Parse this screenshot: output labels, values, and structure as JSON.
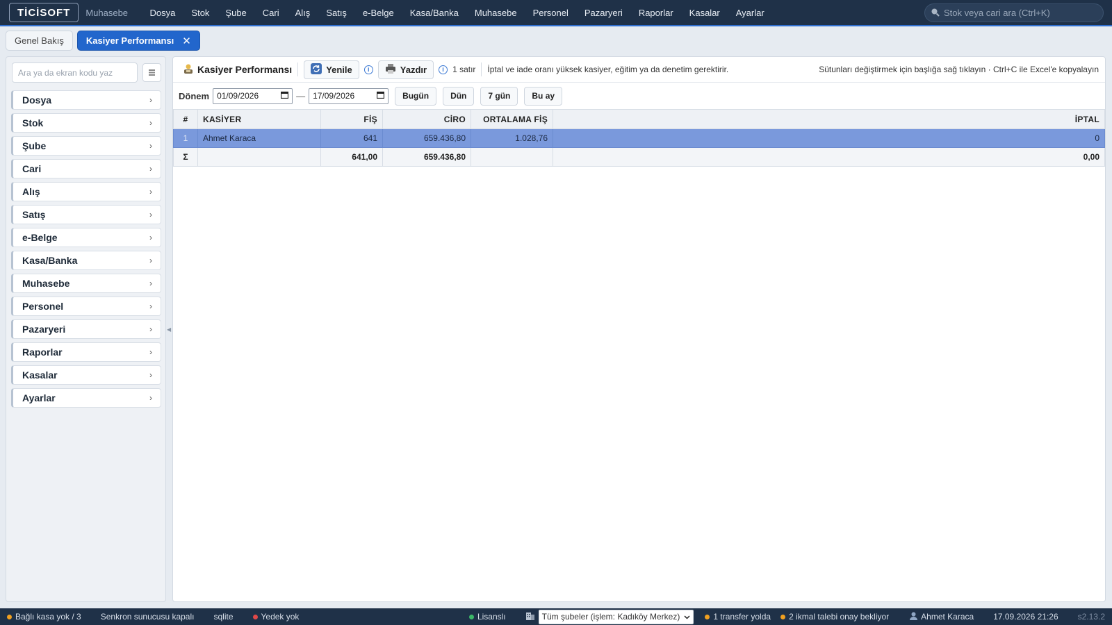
{
  "app": {
    "logo": "TİCİSOFT",
    "subtitle": "Muhasebe",
    "menu": [
      "Dosya",
      "Stok",
      "Şube",
      "Cari",
      "Alış",
      "Satış",
      "e-Belge",
      "Kasa/Banka",
      "Muhasebe",
      "Personel",
      "Pazaryeri",
      "Raporlar",
      "Kasalar",
      "Ayarlar"
    ],
    "search_placeholder": "Stok veya cari ara (Ctrl+K)"
  },
  "tabs": [
    {
      "label": "Genel Bakış",
      "active": false
    },
    {
      "label": "Kasiyer Performansı",
      "active": true,
      "close": "✕"
    }
  ],
  "sidebar": {
    "search_placeholder": "Ara ya da ekran kodu yaz",
    "items": [
      "Dosya",
      "Stok",
      "Şube",
      "Cari",
      "Alış",
      "Satış",
      "e-Belge",
      "Kasa/Banka",
      "Muhasebe",
      "Personel",
      "Pazaryeri",
      "Raporlar",
      "Kasalar",
      "Ayarlar"
    ]
  },
  "toolbar": {
    "title": "Kasiyer Performansı",
    "refresh_label": "Yenile",
    "print_label": "Yazdır",
    "row_count": "1 satır",
    "note": "İptal ve iade oranı yüksek kasiyer, eğitim ya da denetim gerektirir.",
    "hint": "Sütunları değiştirmek için başlığa sağ tıklayın · Ctrl+C ile Excel'e kopyalayın"
  },
  "filter": {
    "label": "Dönem",
    "date_from": "01/09/2026",
    "date_to": "17/09/2026",
    "separator": "—",
    "quick": [
      "Bugün",
      "Dün",
      "7 gün",
      "Bu ay"
    ]
  },
  "table": {
    "columns": {
      "idx": "#",
      "cashier": "KASİYER",
      "receipts": "FİŞ",
      "revenue": "CİRO",
      "avg": "ORTALAMA FİŞ",
      "cancel": "İPTAL"
    },
    "rows": [
      {
        "idx": "1",
        "cashier": "Ahmet Karaca",
        "receipts": "641",
        "revenue": "659.436,80",
        "avg": "1.028,76",
        "cancel": "0"
      }
    ],
    "total": {
      "symbol": "Σ",
      "receipts": "641,00",
      "revenue": "659.436,80",
      "cancel": "0,00"
    }
  },
  "status": {
    "till": "Bağlı kasa yok / 3",
    "sync": "Senkron sunucusu kapalı",
    "db": "sqlite",
    "backup": "Yedek yok",
    "license": "Lisanslı",
    "branch_select": "Tüm şubeler (işlem: Kadıköy Merkez)",
    "transfer": "1 transfer yolda",
    "replenish": "2 ikmal talebi onay bekliyor",
    "user": "Ahmet Karaca",
    "datetime": "17.09.2026 21:26",
    "version": "s2.13.2"
  },
  "colors": {
    "nav": "#1f3148",
    "accent": "#2266cc",
    "selected_row": "#7a99dc",
    "dot_orange": "#f0a020",
    "dot_red": "#e04848",
    "dot_green": "#3cb868"
  }
}
